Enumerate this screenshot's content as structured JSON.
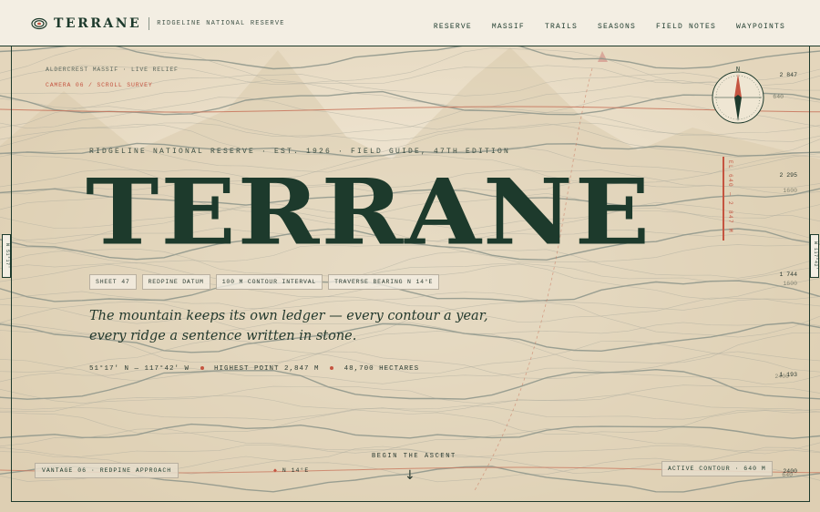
{
  "brand": {
    "name": "TERRANE",
    "subtitle": "RIDGELINE NATIONAL RESERVE"
  },
  "nav": [
    "RESERVE",
    "MASSIF",
    "TRAILS",
    "SEASONS",
    "FIELD NOTES",
    "WAYPOINTS"
  ],
  "hero": {
    "location": "ALDERCREST MASSIF · LIVE RELIEF",
    "camera": "CAMERA 06 / SCROLL SURVEY",
    "eyebrow": "RIDGELINE NATIONAL RESERVE  ·  EST. 1926  ·  FIELD GUIDE, 47TH EDITION",
    "title": "TERRANE",
    "tags": [
      "SHEET 47",
      "REDPINE DATUM",
      "100 M CONTOUR INTERVAL",
      "TRAVERSE BEARING N 14°E"
    ],
    "tagline": "The mountain keeps its own ledger — every contour a year, every ridge a sentence written in stone.",
    "coords": "51°17′ N — 117°42′ W",
    "highest": "HIGHEST POINT 2,847 M",
    "hectares": "48,700 HECTARES"
  },
  "compass": {
    "label": "N"
  },
  "elevation_scale": [
    "2 847",
    "640",
    "2 295",
    "1600",
    "1 744",
    "1600",
    "1 193",
    "2400",
    "2400",
    "640"
  ],
  "elevation_bar": "EL 640 — 2 847 M",
  "side_left": "N 51°17′",
  "side_right": "W 117°42′",
  "bottom": {
    "vantage": "VANTAGE 06 · REDPINE APPROACH",
    "bearing": "N 14°E",
    "ascent": "BEGIN THE ASCENT",
    "active": "ACTIVE CONTOUR · 640 M"
  },
  "colors": {
    "ink": "#1d3a2c",
    "accent": "#c55440",
    "paper": "#efe8d9"
  }
}
